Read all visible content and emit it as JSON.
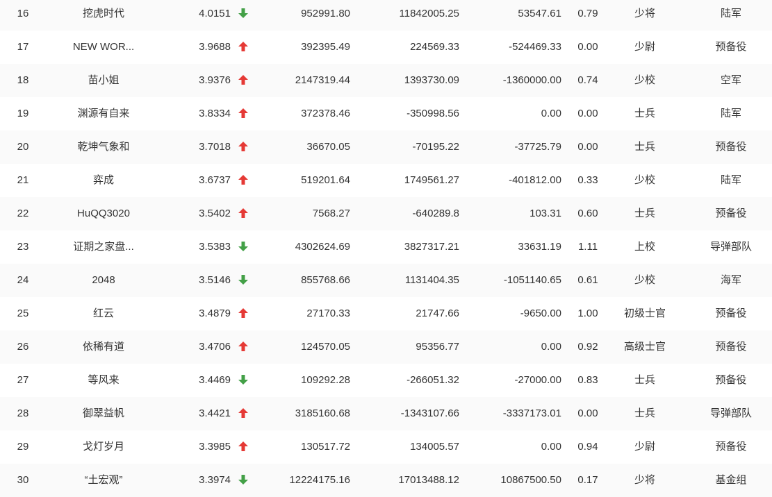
{
  "colors": {
    "up": "#e53935",
    "down": "#43a047",
    "text": "#333333",
    "row_alt": "#fafafa"
  },
  "rows": [
    {
      "rank": "16",
      "name": "挖虎时代",
      "score": "4.0151",
      "trend": "down",
      "v1": "952991.80",
      "v2": "11842005.25",
      "v3": "53547.61",
      "ratio": "0.79",
      "title": "少将",
      "branch": "陆军"
    },
    {
      "rank": "17",
      "name": "NEW WOR...",
      "score": "3.9688",
      "trend": "up",
      "v1": "392395.49",
      "v2": "224569.33",
      "v3": "-524469.33",
      "ratio": "0.00",
      "title": "少尉",
      "branch": "预备役"
    },
    {
      "rank": "18",
      "name": "苗小姐",
      "score": "3.9376",
      "trend": "up",
      "v1": "2147319.44",
      "v2": "1393730.09",
      "v3": "-1360000.00",
      "ratio": "0.74",
      "title": "少校",
      "branch": "空军"
    },
    {
      "rank": "19",
      "name": "渊源有自来",
      "score": "3.8334",
      "trend": "up",
      "v1": "372378.46",
      "v2": "-350998.56",
      "v3": "0.00",
      "ratio": "0.00",
      "title": "士兵",
      "branch": "陆军"
    },
    {
      "rank": "20",
      "name": "乾坤气象和",
      "score": "3.7018",
      "trend": "up",
      "v1": "36670.05",
      "v2": "-70195.22",
      "v3": "-37725.79",
      "ratio": "0.00",
      "title": "士兵",
      "branch": "预备役"
    },
    {
      "rank": "21",
      "name": "弈成",
      "score": "3.6737",
      "trend": "up",
      "v1": "519201.64",
      "v2": "1749561.27",
      "v3": "-401812.00",
      "ratio": "0.33",
      "title": "少校",
      "branch": "陆军"
    },
    {
      "rank": "22",
      "name": "HuQQ3020",
      "score": "3.5402",
      "trend": "up",
      "v1": "7568.27",
      "v2": "-640289.8",
      "v3": "103.31",
      "ratio": "0.60",
      "title": "士兵",
      "branch": "预备役"
    },
    {
      "rank": "23",
      "name": "证期之家盘...",
      "score": "3.5383",
      "trend": "down",
      "v1": "4302624.69",
      "v2": "3827317.21",
      "v3": "33631.19",
      "ratio": "1.11",
      "title": "上校",
      "branch": "导弹部队"
    },
    {
      "rank": "24",
      "name": "2048",
      "score": "3.5146",
      "trend": "down",
      "v1": "855768.66",
      "v2": "1131404.35",
      "v3": "-1051140.65",
      "ratio": "0.61",
      "title": "少校",
      "branch": "海军"
    },
    {
      "rank": "25",
      "name": "红云",
      "score": "3.4879",
      "trend": "up",
      "v1": "27170.33",
      "v2": "21747.66",
      "v3": "-9650.00",
      "ratio": "1.00",
      "title": "初级士官",
      "branch": "预备役"
    },
    {
      "rank": "26",
      "name": "依稀有道",
      "score": "3.4706",
      "trend": "up",
      "v1": "124570.05",
      "v2": "95356.77",
      "v3": "0.00",
      "ratio": "0.92",
      "title": "高级士官",
      "branch": "预备役"
    },
    {
      "rank": "27",
      "name": "等风来",
      "score": "3.4469",
      "trend": "down",
      "v1": "109292.28",
      "v2": "-266051.32",
      "v3": "-27000.00",
      "ratio": "0.83",
      "title": "士兵",
      "branch": "预备役"
    },
    {
      "rank": "28",
      "name": "御翠益帆",
      "score": "3.4421",
      "trend": "up",
      "v1": "3185160.68",
      "v2": "-1343107.66",
      "v3": "-3337173.01",
      "ratio": "0.00",
      "title": "士兵",
      "branch": "导弹部队"
    },
    {
      "rank": "29",
      "name": "戈灯岁月",
      "score": "3.3985",
      "trend": "up",
      "v1": "130517.72",
      "v2": "134005.57",
      "v3": "0.00",
      "ratio": "0.94",
      "title": "少尉",
      "branch": "预备役"
    },
    {
      "rank": "30",
      "name": "“土宏观”",
      "score": "3.3974",
      "trend": "down",
      "v1": "12224175.16",
      "v2": "17013488.12",
      "v3": "10867500.50",
      "ratio": "0.17",
      "title": "少将",
      "branch": "基金组"
    }
  ]
}
